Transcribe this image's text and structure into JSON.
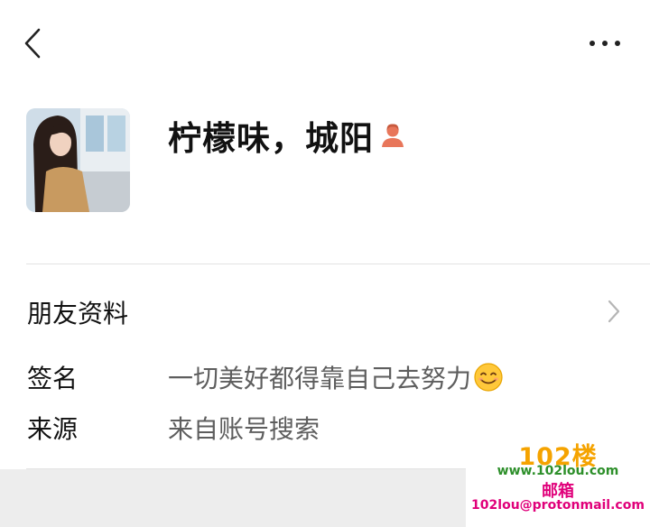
{
  "header": {
    "back_icon": "chevron-left-icon",
    "more_icon": "more-horizontal-icon"
  },
  "profile": {
    "avatar_icon": "avatar-photo",
    "name": "柠檬味，城阳",
    "gender_icon": "female-user-icon",
    "gender_color": "#e8765a"
  },
  "friend_info": {
    "label": "朋友资料",
    "chevron_icon": "chevron-right-icon"
  },
  "details": [
    {
      "label": "签名",
      "value": "一切美好都得靠自己去努力",
      "emoji": "smiling-face-icon"
    },
    {
      "label": "来源",
      "value": "来自账号搜索"
    }
  ],
  "watermark": {
    "brand": "102楼",
    "url": "www.102lou.com",
    "mail_label": "邮箱",
    "email": "102lou@protonmail.com"
  },
  "colors": {
    "background": "#ffffff",
    "divider": "#e3e3e3",
    "secondary_text": "#5e5e5e",
    "bottom_band": "#ededed"
  }
}
